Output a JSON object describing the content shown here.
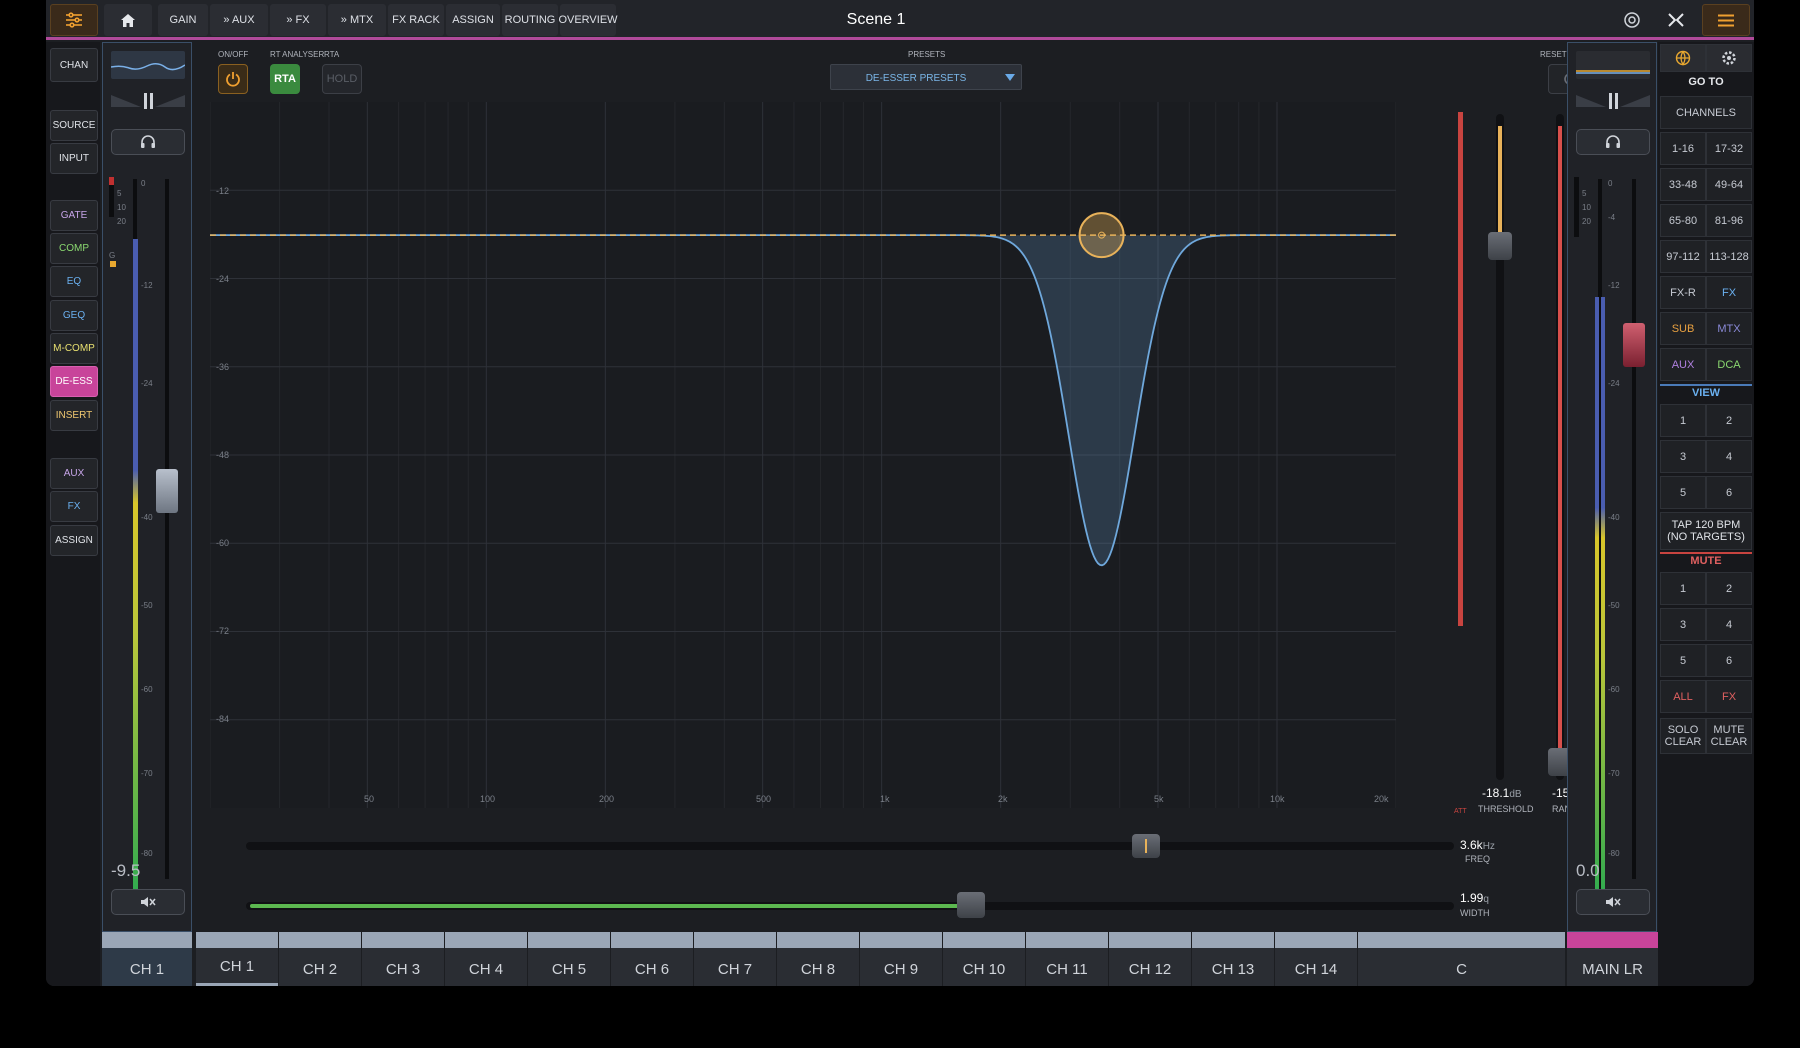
{
  "topbar": {
    "gain": "GAIN",
    "aux": "» AUX",
    "fx": "» FX",
    "mtx": "» MTX",
    "fxrack": "FX RACK",
    "assign": "ASSIGN",
    "routing": "ROUTING",
    "overview": "OVERVIEW",
    "scene": "Scene 1"
  },
  "left": {
    "chan": "CHAN",
    "source": "SOURCE",
    "input": "INPUT",
    "gate": "GATE",
    "comp": "COMP",
    "eq": "EQ",
    "geq": "GEQ",
    "mcomp": "M-COMP",
    "deess": "DE-ESS",
    "insert": "INSERT",
    "aux": "AUX",
    "fx": "FX",
    "assign": "ASSIGN"
  },
  "strip_left": {
    "value": "-9.5",
    "name": "CH 1",
    "scale": [
      "0",
      "-12",
      "-24",
      "-40",
      "-50",
      "-60",
      "-70",
      "-80"
    ],
    "small_scale": [
      "5",
      "10",
      "20"
    ],
    "g": "G"
  },
  "strip_main": {
    "value": "0.0",
    "name": "MAIN LR",
    "scale": [
      "0",
      "-4",
      "-12",
      "-24",
      "-40",
      "-50",
      "-60",
      "-70",
      "-80"
    ],
    "small_scale": [
      "5",
      "10",
      "20"
    ]
  },
  "deesser": {
    "onoff_label": "ON/OFF",
    "rta_analyser_label": "RT ANALYSER",
    "rta_label": "RTA",
    "rta_btn": "RTA",
    "hold_btn": "HOLD",
    "presets_label": "PRESETS",
    "preset_select": "DE-ESSER PRESETS",
    "reset_label": "RESET",
    "y_ticks": [
      "-12",
      "-24",
      "-36",
      "-48",
      "-60",
      "-72",
      "-84"
    ],
    "x_ticks": [
      "50",
      "100",
      "200",
      "500",
      "1k",
      "2k",
      "5k",
      "10k",
      "20k"
    ],
    "att": "ATT",
    "threshold_value": "-18.1",
    "threshold_unit": "dB",
    "threshold_label": "THRESHOLD",
    "range_value": "-15",
    "range_unit": "dB",
    "range_label": "RANGE",
    "freq_value": "3.6k",
    "freq_unit": "Hz",
    "freq_label": "FREQ",
    "width_value": "1.99",
    "width_unit": "q",
    "width_label": "WIDTH",
    "threshold_db": -18.1,
    "range_db": -15,
    "freq_hz": 3600,
    "width_q": 1.99,
    "width_slider_fraction": 0.6
  },
  "channels": [
    "CH 1",
    "CH 2",
    "CH 3",
    "CH 4",
    "CH 5",
    "CH 6",
    "CH 7",
    "CH 8",
    "CH 9",
    "CH 10",
    "CH 11",
    "CH 12",
    "CH 13",
    "CH 14",
    "C"
  ],
  "right": {
    "goto": "GO TO",
    "channels": "CHANNELS",
    "ranges": [
      "1-16",
      "17-32",
      "33-48",
      "49-64",
      "65-80",
      "81-96",
      "97-112",
      "113-128"
    ],
    "fxr": "FX-R",
    "fx": "FX",
    "sub": "SUB",
    "mtx": "MTX",
    "aux": "AUX",
    "dca": "DCA",
    "view": "VIEW",
    "view_nums": [
      "1",
      "2",
      "3",
      "4",
      "5",
      "6"
    ],
    "tap1": "TAP 120 BPM",
    "tap2": "(NO TARGETS)",
    "mute": "MUTE",
    "mute_nums": [
      "1",
      "2",
      "3",
      "4",
      "5",
      "6"
    ],
    "all": "ALL",
    "mfx": "FX",
    "solo1": "SOLO",
    "solo2": "CLEAR",
    "mute1": "MUTE",
    "mute2": "CLEAR"
  },
  "colors": {
    "accent": "#f0a030",
    "deess": "#c8449a",
    "curve": "#6fa8dc",
    "threshold": "#e8b25a",
    "range": "#d8504c",
    "rta_green": "#3a8a3e"
  }
}
